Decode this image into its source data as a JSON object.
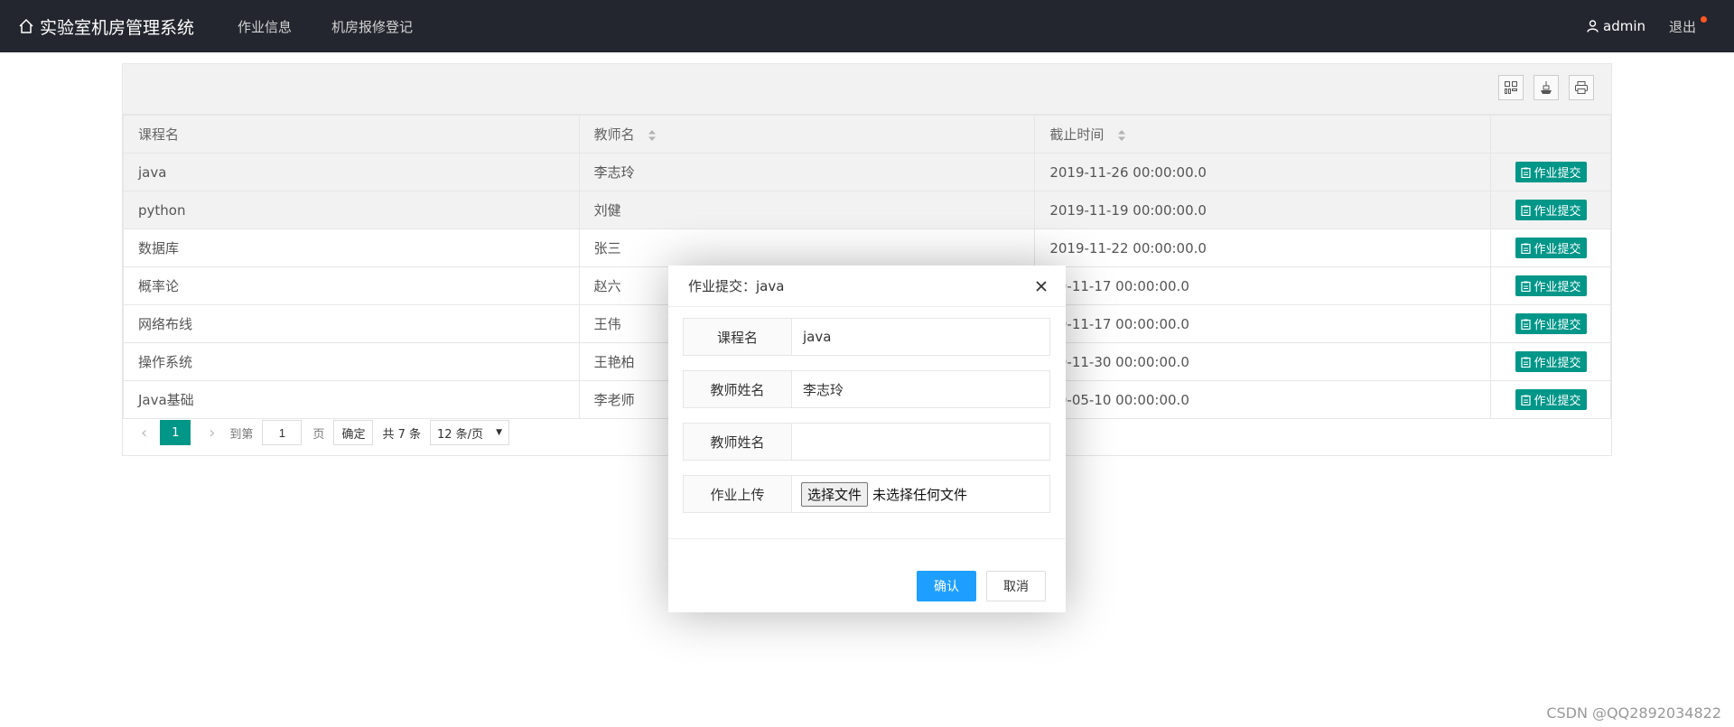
{
  "header": {
    "title": "实验室机房管理系统",
    "nav": [
      "作业信息",
      "机房报修登记"
    ],
    "user": "admin",
    "logout": "退出"
  },
  "table": {
    "columns": [
      "课程名",
      "教师名",
      "截止时间",
      ""
    ],
    "submit_label": "作业提交",
    "rows": [
      {
        "course": "java",
        "teacher": "李志玲",
        "deadline": "2019-11-26 00:00:00.0"
      },
      {
        "course": "python",
        "teacher": "刘健",
        "deadline": "2019-11-19 00:00:00.0"
      },
      {
        "course": "数据库",
        "teacher": "张三",
        "deadline": "2019-11-22 00:00:00.0"
      },
      {
        "course": "概率论",
        "teacher": "赵六",
        "deadline": "19-11-17 00:00:00.0"
      },
      {
        "course": "网络布线",
        "teacher": "王伟",
        "deadline": "19-11-17 00:00:00.0"
      },
      {
        "course": "操作系统",
        "teacher": "王艳柏",
        "deadline": "19-11-30 00:00:00.0"
      },
      {
        "course": "Java基础",
        "teacher": "李老师",
        "deadline": "20-05-10 00:00:00.0"
      }
    ]
  },
  "pager": {
    "current": "1",
    "goto_label": "到第",
    "goto_value": "1",
    "page_unit": "页",
    "confirm": "确定",
    "total": "共 7 条",
    "per_page": "12 条/页"
  },
  "modal": {
    "title": "作业提交：java",
    "fields": [
      {
        "label": "课程名",
        "value": "java"
      },
      {
        "label": "教师姓名",
        "value": "李志玲"
      },
      {
        "label": "教师姓名",
        "value": ""
      },
      {
        "label": "作业上传",
        "value": ""
      }
    ],
    "file_button": "选择文件",
    "file_status": "未选择任何文件",
    "ok": "确认",
    "cancel": "取消"
  },
  "watermark": "CSDN @QQ2892034822"
}
